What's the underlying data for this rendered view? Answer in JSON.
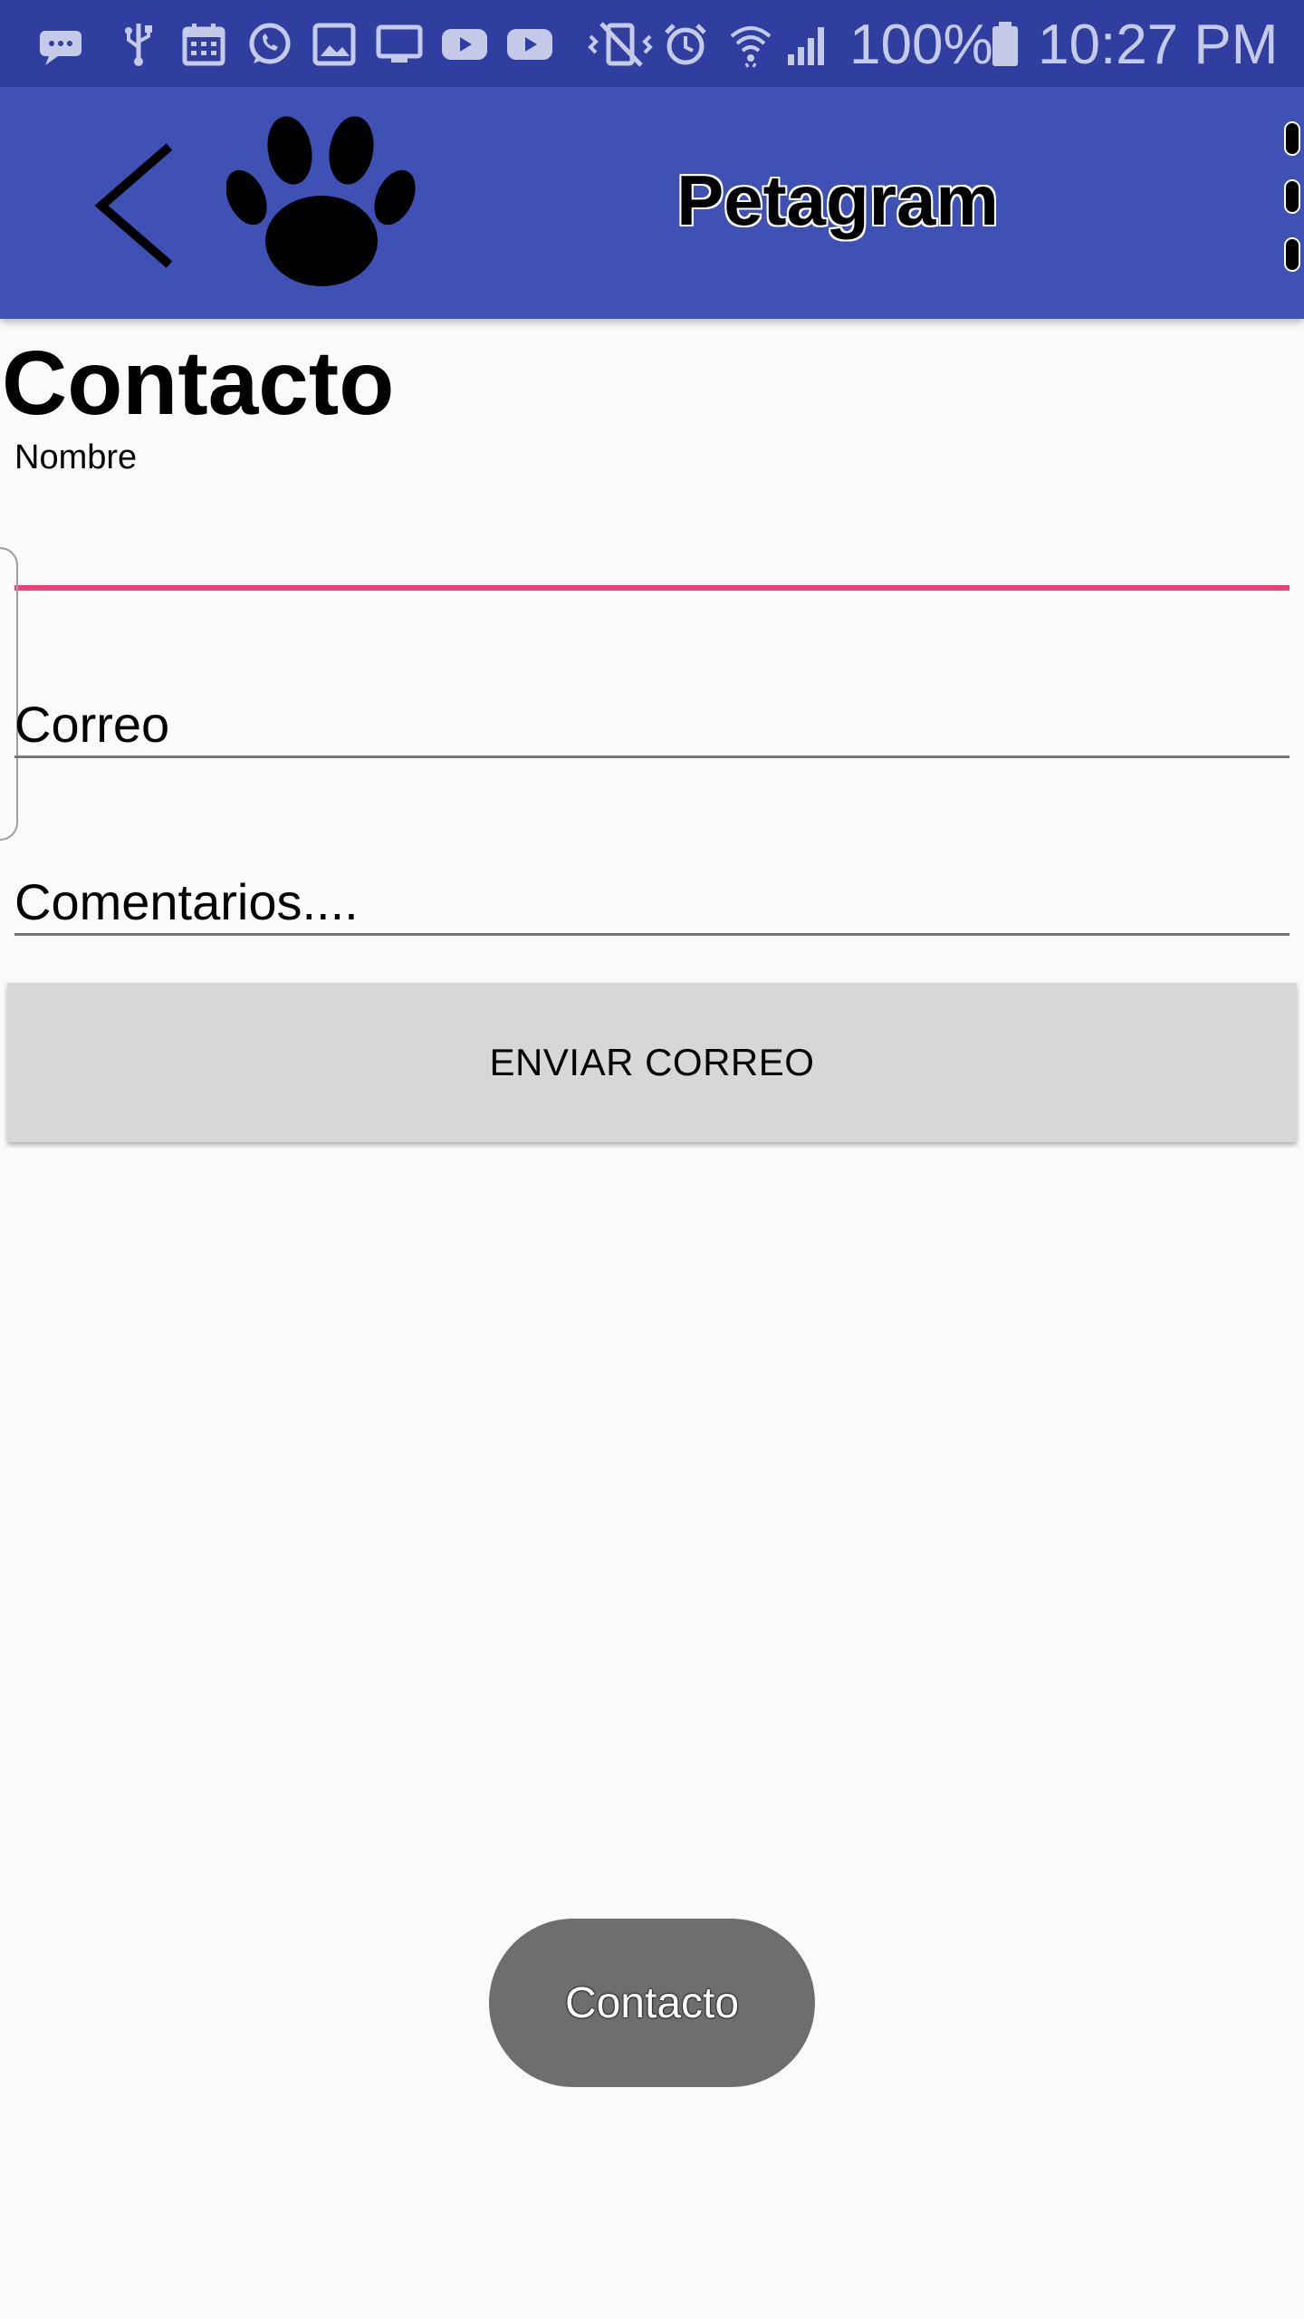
{
  "status_bar": {
    "battery_percent": "100%",
    "time": "10:27 PM",
    "icons": [
      "message-icon",
      "usb-icon",
      "calendar-icon",
      "whatsapp-icon",
      "gallery-icon",
      "cast-icon",
      "youtube-icon",
      "youtube-icon",
      "vibrate-icon",
      "alarm-icon",
      "wifi-icon",
      "signal-icon",
      "battery-icon"
    ]
  },
  "app_bar": {
    "title": "Petagram",
    "back_icon": "chevron-left-icon",
    "logo_icon": "paw-icon",
    "menu_icon": "overflow-menu-icon"
  },
  "page": {
    "title": "Contacto"
  },
  "form": {
    "name_label": "Nombre",
    "name_value": "",
    "email_placeholder": "Correo",
    "comments_placeholder": "Comentarios....",
    "send_label": "ENVIAR CORREO"
  },
  "toast": {
    "message": "Contacto"
  },
  "colors": {
    "status_bar": "#303f9f",
    "app_bar": "#3f51b5",
    "accent": "#ec407a",
    "background": "#fafafa",
    "button": "#d6d7d7",
    "toast": "#6e6e6e"
  }
}
